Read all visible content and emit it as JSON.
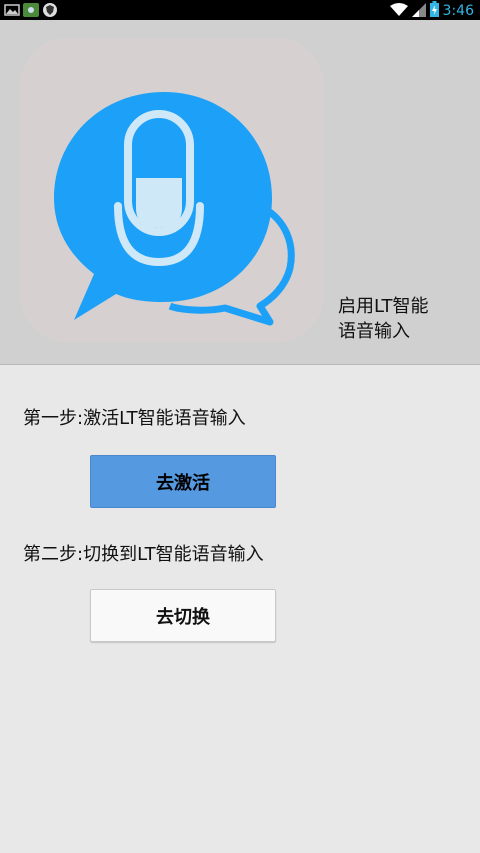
{
  "status_bar": {
    "time": "3:46",
    "icons": [
      "image-icon",
      "app-icon",
      "shield-icon",
      "wifi-icon",
      "signal-icon",
      "battery-icon"
    ]
  },
  "header": {
    "title_line1": "启用LT智能",
    "title_line2": "语音输入",
    "logo_icon": "microphone-chat-bubble-icon"
  },
  "steps": [
    {
      "label": "第一步:激活LT智能语音输入",
      "button": "去激活"
    },
    {
      "label": "第二步:切换到LT智能语音输入",
      "button": "去切换"
    }
  ],
  "colors": {
    "accent": "#1da1f8",
    "activate_button": "#5599e0",
    "time": "#33b5e5"
  }
}
